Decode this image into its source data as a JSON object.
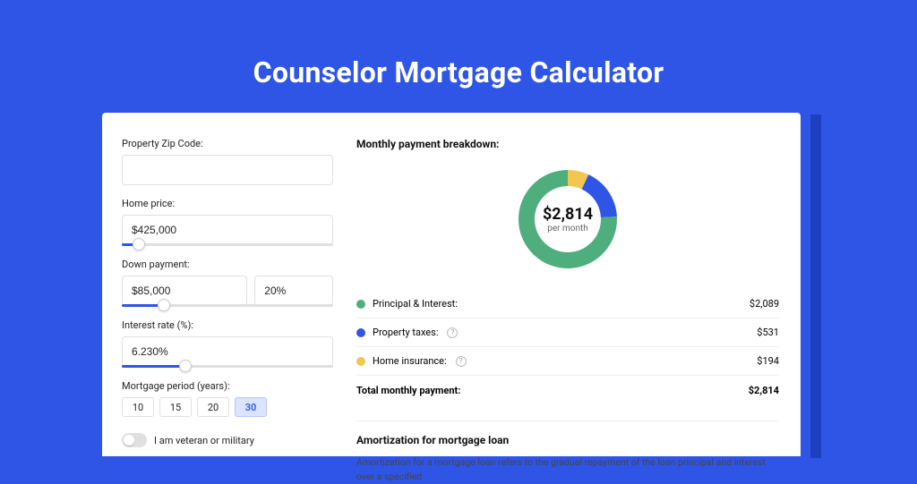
{
  "title": "Counselor Mortgage Calculator",
  "form": {
    "zip": {
      "label": "Property Zip Code:",
      "value": ""
    },
    "home_price": {
      "label": "Home price:",
      "value": "$425,000",
      "slider_pct": 8
    },
    "down_payment": {
      "label": "Down payment:",
      "amount": "$85,000",
      "percent": "20%",
      "slider_pct": 20
    },
    "interest_rate": {
      "label": "Interest rate (%):",
      "value": "6.230%",
      "slider_pct": 30
    },
    "mortgage_period": {
      "label": "Mortgage period (years):",
      "options": [
        "10",
        "15",
        "20",
        "30"
      ],
      "selected": "30"
    },
    "veteran": {
      "label": "I am veteran or military",
      "on": false
    }
  },
  "breakdown": {
    "title": "Monthly payment breakdown:",
    "center_amount": "$2,814",
    "center_sub": "per month",
    "rows": [
      {
        "dot": "green",
        "label": "Principal & Interest:",
        "help": false,
        "value": "$2,089"
      },
      {
        "dot": "blue",
        "label": "Property taxes:",
        "help": true,
        "value": "$531"
      },
      {
        "dot": "yellow",
        "label": "Home insurance:",
        "help": true,
        "value": "$194"
      }
    ],
    "total_label": "Total monthly payment:",
    "total_value": "$2,814"
  },
  "chart_data": {
    "type": "pie",
    "title": "Monthly payment breakdown",
    "series": [
      {
        "name": "Principal & Interest",
        "value": 2089,
        "color": "#4fae7d"
      },
      {
        "name": "Property taxes",
        "value": 531,
        "color": "#2f55e6"
      },
      {
        "name": "Home insurance",
        "value": 194,
        "color": "#f3c64f"
      }
    ],
    "total": 2814,
    "center_label": "$2,814 per month"
  },
  "amortization": {
    "title": "Amortization for mortgage loan",
    "text": "Amortization for a mortgage loan refers to the gradual repayment of the loan principal and interest over a specified"
  }
}
